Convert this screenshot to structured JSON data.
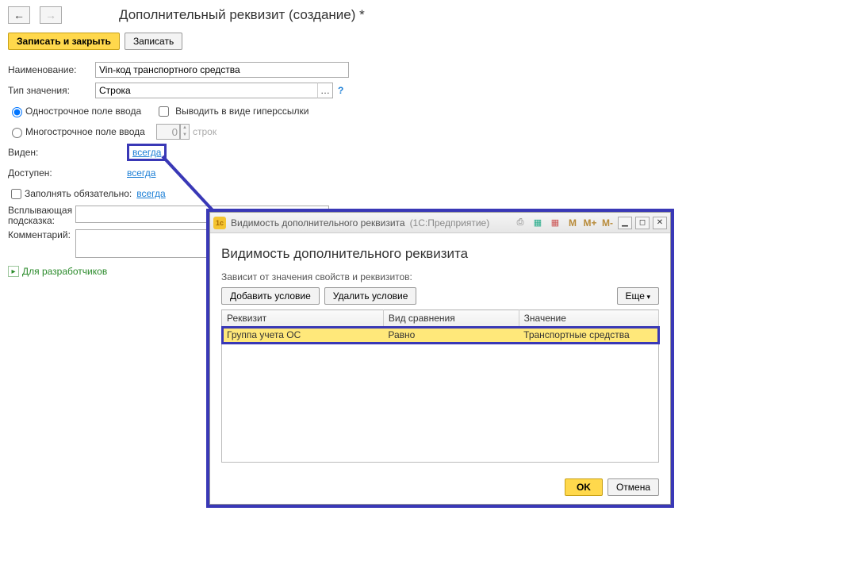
{
  "header": {
    "title": "Дополнительный реквизит (создание) *"
  },
  "toolbar": {
    "save_close": "Записать и закрыть",
    "save": "Записать"
  },
  "form": {
    "name_label": "Наименование:",
    "name_value": "Vin-код транспортного средства",
    "type_label": "Тип значения:",
    "type_value": "Строка",
    "single_line": "Однострочное поле ввода",
    "multi_line": "Многострочное поле ввода",
    "hyperlink_checkbox": "Выводить в виде гиперссылки",
    "lines_value": "0",
    "lines_word": "строк",
    "visible_label": "Виден:",
    "visible_link": "всегда",
    "available_label": "Доступен:",
    "available_link": "всегда",
    "required_label": "Заполнять обязательно:",
    "required_link": "всегда",
    "tooltip_label": "Всплывающая подсказка:",
    "comment_label": "Комментарий:",
    "dev_link": "Для разработчиков"
  },
  "dialog": {
    "titlebar": "Видимость дополнительного реквизита",
    "titlebar_sub": "(1С:Предприятие)",
    "icons": {
      "m": "M",
      "mplus": "M+",
      "mminus": "M-"
    },
    "heading": "Видимость дополнительного реквизита",
    "depends": "Зависит от значения свойств и реквизитов:",
    "add_cond": "Добавить условие",
    "del_cond": "Удалить условие",
    "more": "Еще",
    "columns": {
      "attr": "Реквизит",
      "cmp": "Вид сравнения",
      "val": "Значение"
    },
    "row": {
      "attr": "Группа учета ОС",
      "cmp": "Равно",
      "val": "Транспортные средства"
    },
    "ok": "OK",
    "cancel": "Отмена"
  }
}
